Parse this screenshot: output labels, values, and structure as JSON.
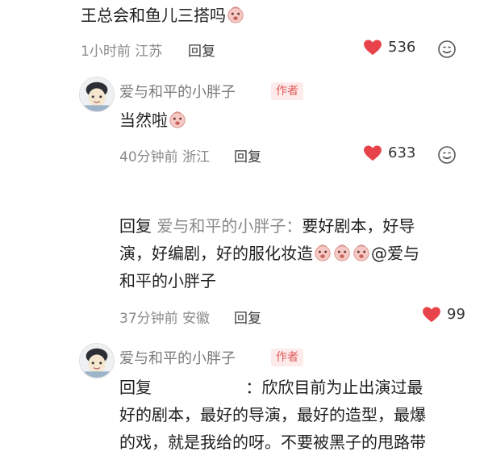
{
  "comment1": {
    "text": "王总会和鱼儿三搭吗",
    "time": "1小时前",
    "location": "江苏",
    "reply_label": "回复",
    "likes": "536"
  },
  "comment2": {
    "username": "爱与和平的小胖子",
    "badge": "作者",
    "text": "当然啦",
    "time": "40分钟前",
    "location": "浙江",
    "reply_label": "回复",
    "likes": "633"
  },
  "comment3": {
    "prefix": "回复",
    "target": "爱与和平的小胖子：",
    "line1": "要好剧本，好导",
    "line2a": "演，好编剧，好的服化妆造",
    "mention": "@爱与",
    "line3": "和平的小胖子",
    "time": "37分钟前",
    "location": "安徽",
    "reply_label": "回复",
    "likes": "99"
  },
  "comment4": {
    "username": "爱与和平的小胖子",
    "badge": "作者",
    "prefix": "回复",
    "line1": "：欣欣目前为止出演过最",
    "line2": "好的剧本，最好的导演，最好的造型，最爆",
    "line3": "的戏，就是我给的呀。不要被黑子的甩路带"
  },
  "colors": {
    "heart": "#e8424a",
    "badge_text": "#e05a5a",
    "badge_bg": "#fdeaea"
  }
}
